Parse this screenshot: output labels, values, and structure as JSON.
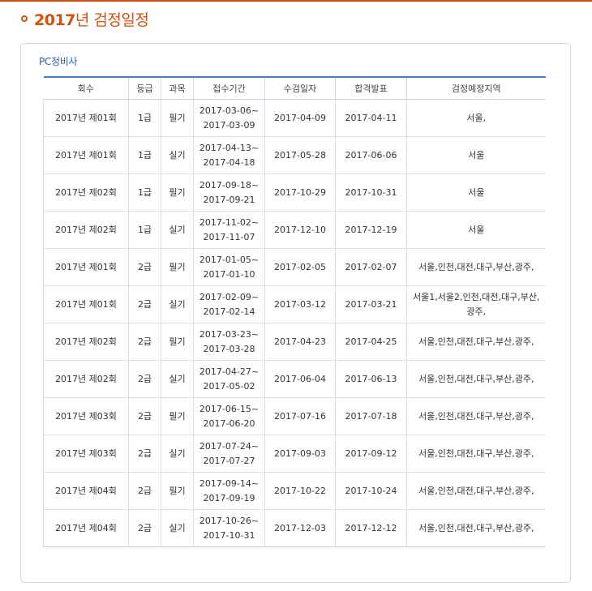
{
  "page": {
    "title_year": "2017",
    "title_rest": "년 검정일정",
    "section_label": "PC정비사"
  },
  "colors": {
    "accent": "#d24f0c",
    "section_label": "#2a63a8",
    "table_header_border": "#4a7ec0"
  },
  "table": {
    "headers": [
      "회수",
      "등급",
      "과목",
      "접수기간",
      "수검일자",
      "합격발표",
      "검정예정지역"
    ],
    "rows": [
      {
        "round": "2017년 제01회",
        "grade": "1급",
        "subject": "필기",
        "period_start": "2017-03-06~",
        "period_end": "2017-03-09",
        "exam_date": "2017-04-09",
        "result_date": "2017-04-11",
        "region": "서울,"
      },
      {
        "round": "2017년 제01회",
        "grade": "1급",
        "subject": "실기",
        "period_start": "2017-04-13~",
        "period_end": "2017-04-18",
        "exam_date": "2017-05-28",
        "result_date": "2017-06-06",
        "region": "서울"
      },
      {
        "round": "2017년 제02회",
        "grade": "1급",
        "subject": "필기",
        "period_start": "2017-09-18~",
        "period_end": "2017-09-21",
        "exam_date": "2017-10-29",
        "result_date": "2017-10-31",
        "region": "서울"
      },
      {
        "round": "2017년 제02회",
        "grade": "1급",
        "subject": "실기",
        "period_start": "2017-11-02~",
        "period_end": "2017-11-07",
        "exam_date": "2017-12-10",
        "result_date": "2017-12-19",
        "region": "서울"
      },
      {
        "round": "2017년 제01회",
        "grade": "2급",
        "subject": "필기",
        "period_start": "2017-01-05~",
        "period_end": "2017-01-10",
        "exam_date": "2017-02-05",
        "result_date": "2017-02-07",
        "region": "서울,인천,대전,대구,부산,광주,"
      },
      {
        "round": "2017년 제01회",
        "grade": "2급",
        "subject": "실기",
        "period_start": "2017-02-09~",
        "period_end": "2017-02-14",
        "exam_date": "2017-03-12",
        "result_date": "2017-03-21",
        "region": "서울1,서울2,인천,대전,대구,부산,광주,"
      },
      {
        "round": "2017년 제02회",
        "grade": "2급",
        "subject": "필기",
        "period_start": "2017-03-23~",
        "period_end": "2017-03-28",
        "exam_date": "2017-04-23",
        "result_date": "2017-04-25",
        "region": "서울,인천,대전,대구,부산,광주,"
      },
      {
        "round": "2017년 제02회",
        "grade": "2급",
        "subject": "실기",
        "period_start": "2017-04-27~",
        "period_end": "2017-05-02",
        "exam_date": "2017-06-04",
        "result_date": "2017-06-13",
        "region": "서울,인천,대전,대구,부산,광주,"
      },
      {
        "round": "2017년 제03회",
        "grade": "2급",
        "subject": "필기",
        "period_start": "2017-06-15~",
        "period_end": "2017-06-20",
        "exam_date": "2017-07-16",
        "result_date": "2017-07-18",
        "region": "서울,인천,대전,대구,부산,광주,"
      },
      {
        "round": "2017년 제03회",
        "grade": "2급",
        "subject": "실기",
        "period_start": "2017-07-24~",
        "period_end": "2017-07-27",
        "exam_date": "2017-09-03",
        "result_date": "2017-09-12",
        "region": "서울,인천,대전,대구,부산,광주,"
      },
      {
        "round": "2017년 제04회",
        "grade": "2급",
        "subject": "필기",
        "period_start": "2017-09-14~",
        "period_end": "2017-09-19",
        "exam_date": "2017-10-22",
        "result_date": "2017-10-24",
        "region": "서울,인천,대전,대구,부산,광주,"
      },
      {
        "round": "2017년 제04회",
        "grade": "2급",
        "subject": "실기",
        "period_start": "2017-10-26~",
        "period_end": "2017-10-31",
        "exam_date": "2017-12-03",
        "result_date": "2017-12-12",
        "region": "서울,인천,대전,대구,부산,광주,"
      }
    ]
  }
}
